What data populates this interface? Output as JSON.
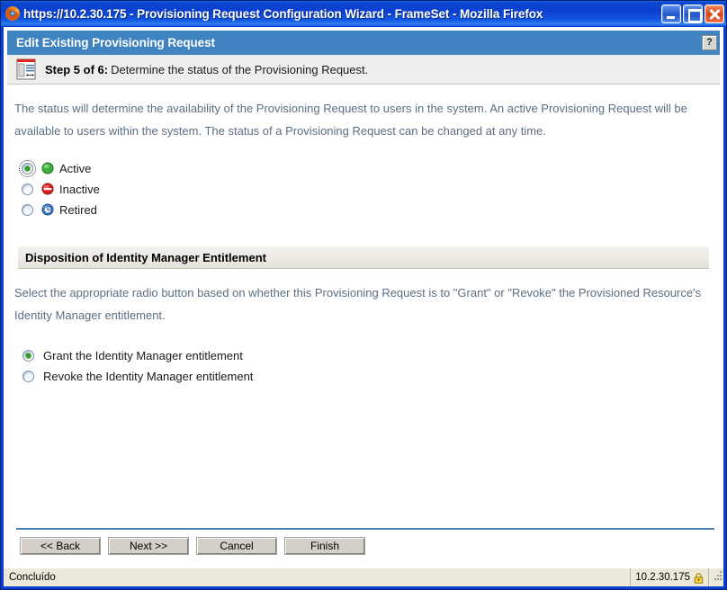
{
  "window": {
    "title": "https://10.2.30.175 - Provisioning Request Configuration Wizard - FrameSet - Mozilla Firefox",
    "browser_icon": "firefox-icon",
    "controls": {
      "minimize": "minimize-button",
      "maximize": "maximize-button",
      "close": "close-button"
    }
  },
  "page_header": {
    "title": "Edit Existing Provisioning Request",
    "help_label": "?",
    "background_color": "#3f83c0"
  },
  "step": {
    "icon": "wizard-step-icon",
    "label": "Step 5 of 6:",
    "description": "Determine the status of the Provisioning Request."
  },
  "intro": {
    "paragraph": "The status will determine the availability of the Provisioning Request to users in the system.  An active Provisioning Request will be available to users within the system.  The status of a Provisioning Request can be changed at any time."
  },
  "status_options": [
    {
      "label": "Active",
      "icon": "status-active-icon",
      "icon_color": "#3fae3f",
      "selected": true,
      "focused": true
    },
    {
      "label": "Inactive",
      "icon": "status-inactive-icon",
      "icon_color": "#e02020",
      "selected": false,
      "focused": false
    },
    {
      "label": "Retired",
      "icon": "status-retired-icon",
      "icon_color": "#3a7fd5",
      "selected": false,
      "focused": false
    }
  ],
  "disposition": {
    "section_title": "Disposition of Identity Manager Entitlement",
    "paragraph": "Select the appropriate radio button based on whether this Provisioning Request is to \"Grant\" or \"Revoke\" the Provisioned Resource's Identity Manager entitlement.",
    "options": [
      {
        "label": "Grant the Identity Manager entitlement",
        "selected": true
      },
      {
        "label": "Revoke the Identity Manager entitlement",
        "selected": false
      }
    ]
  },
  "buttons": [
    {
      "label": "<< Back"
    },
    {
      "label": "Next >>"
    },
    {
      "label": "Cancel"
    },
    {
      "label": "Finish"
    }
  ],
  "statusbar": {
    "message": "Concluído",
    "host": "10.2.30.175",
    "lock_icon": "padlock-icon"
  },
  "colors": {
    "titlebar_blue": "#0b3fd0",
    "header_blue": "#3f83c0",
    "body_text": "#5a6f82",
    "rule_blue": "#4a7fb5",
    "button_face": "#d4d0c8",
    "statusbar_face": "#ece9d8"
  }
}
